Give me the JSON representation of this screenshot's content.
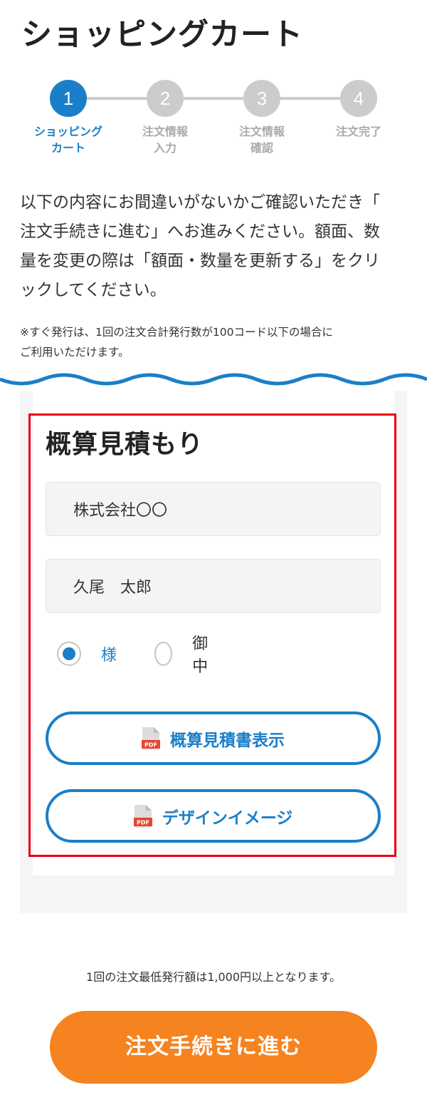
{
  "header": {
    "title": "ショッピングカート"
  },
  "stepper": {
    "steps": [
      {
        "number": "1",
        "label": "ショッピング\nカート",
        "active": true
      },
      {
        "number": "2",
        "label": "注文情報\n入力",
        "active": false
      },
      {
        "number": "3",
        "label": "注文情報\n確認",
        "active": false
      },
      {
        "number": "4",
        "label": "注文完了",
        "active": false
      }
    ]
  },
  "intro": {
    "text": "以下の内容にお間違いがないかご確認いただき「\n注文手続きに進む」へお進みください。額面、数\n量を変更の際は「額面・数量を更新する」をクリ\nックしてください。"
  },
  "note": {
    "text": "※すぐ発行は、1回の注文合計発行数が100コード以下の場合に\nご利用いただけます。"
  },
  "estimate": {
    "title": "概算見積もり",
    "company_value": "株式会社〇〇",
    "name_value": "久尾　太郎",
    "honorific_options": [
      {
        "label": "様",
        "checked": true
      },
      {
        "label": "御中",
        "checked": false
      }
    ],
    "pdf_icon_text": "PDF",
    "estimate_button_label": "概算見積書表示",
    "design_button_label": "デザインイメージ"
  },
  "footer": {
    "min_note": "1回の注文最低発行額は1,000円以上となります。",
    "order_button_label": "注文手続きに進む"
  },
  "colors": {
    "accent": "#1a7fc8",
    "order": "#f5831f",
    "highlight_frame": "#e60012",
    "pdf_red": "#e8452d"
  }
}
